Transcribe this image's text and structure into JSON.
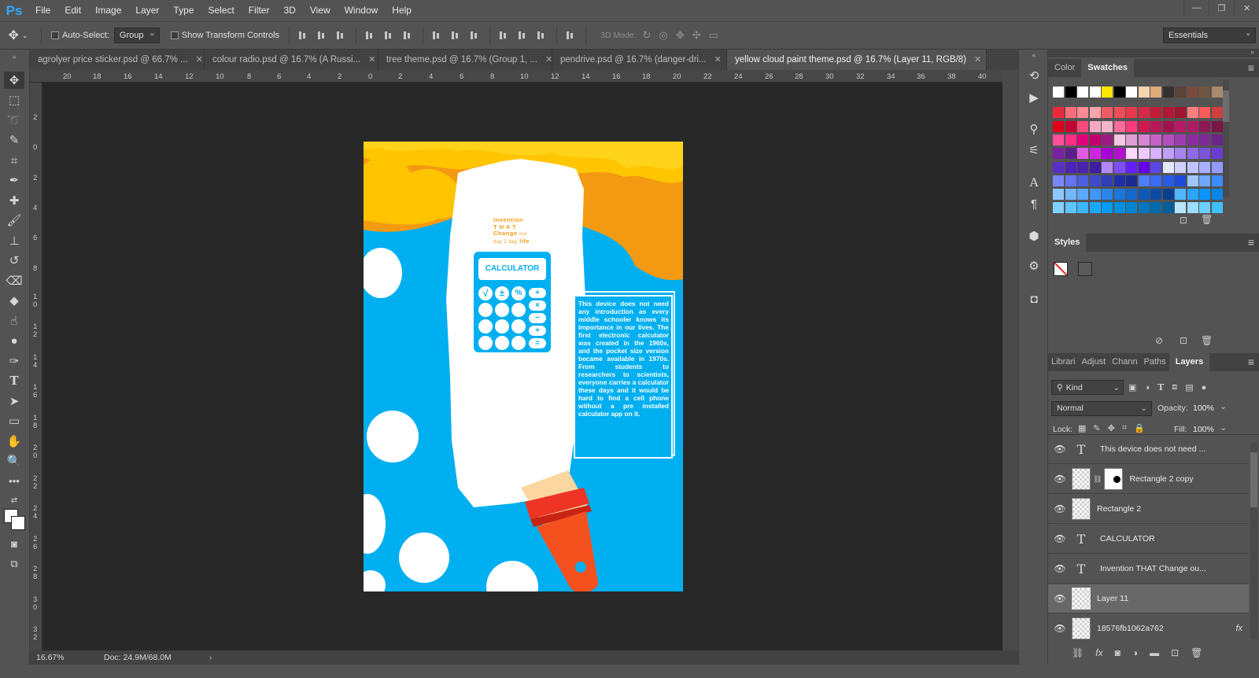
{
  "app": {
    "logo": "Ps"
  },
  "menu": [
    "File",
    "Edit",
    "Image",
    "Layer",
    "Type",
    "Select",
    "Filter",
    "3D",
    "View",
    "Window",
    "Help"
  ],
  "options": {
    "auto_select_label": "Auto-Select:",
    "auto_select_value": "Group",
    "show_transform_label": "Show Transform Controls",
    "mode_3d_label": "3D Mode:",
    "workspace_value": "Essentials"
  },
  "doc_tabs": [
    {
      "label": "agrolyer price sticker.psd @ 66.7% ...",
      "active": false
    },
    {
      "label": "colour radio.psd @ 16.7% (A Russi...",
      "active": false
    },
    {
      "label": "tree theme.psd @ 16.7% (Group 1, ...",
      "active": false
    },
    {
      "label": "pendrive.psd @ 16.7% (danger-dri...",
      "active": false
    },
    {
      "label": "yellow cloud paint theme.psd @ 16.7% (Layer 11, RGB/8)",
      "active": true
    }
  ],
  "ruler_top": [
    "20",
    "18",
    "16",
    "14",
    "12",
    "10",
    "8",
    "6",
    "4",
    "2",
    "0",
    "2",
    "4",
    "6",
    "8",
    "10",
    "12",
    "14",
    "16",
    "18",
    "20",
    "22",
    "24",
    "26",
    "28",
    "30",
    "32",
    "34",
    "36",
    "38",
    "40"
  ],
  "ruler_left": [
    "2",
    "0",
    "2",
    "4",
    "6",
    "8",
    "10",
    "12",
    "14",
    "16",
    "18",
    "20",
    "22",
    "24",
    "26",
    "28",
    "30",
    "32"
  ],
  "status": {
    "zoom": "16.67%",
    "doc": "Doc: 24.9M/68.0M"
  },
  "artwork": {
    "headline_1": "Invention",
    "headline_2": "T H A T",
    "headline_3": "Change",
    "headline_3b": "our",
    "headline_4": "day 2 day",
    "headline_4b": "life",
    "calc_label": "CALCULATOR",
    "key_sqrt": "√",
    "key_pm": "±",
    "key_pct": "%",
    "key_plus": "+",
    "key_times": "×",
    "key_minus": "−",
    "key_plus2": "+",
    "key_eq": "=",
    "body": "This device does not need any introduction as every middle schooler knows its importance in our lives. The first electronic calculator was created in the 1960s, and the pocket size version became available in 1970s. From students to researchers to scientists, everyone carries a calculator these days and it would be hard to find a cell phone without a pre installed calculator app on it."
  },
  "panels": {
    "color_tab": "Color",
    "swatches_tab": "Swatches",
    "styles_tab": "Styles",
    "layer_tabs": [
      "Librari",
      "Adjust",
      "Chann",
      "Paths",
      "Layers"
    ],
    "kind_label": "Kind",
    "blend_mode": "Normal",
    "opacity_label": "Opacity:",
    "opacity_value": "100%",
    "lock_label": "Lock:",
    "fill_label": "Fill:",
    "fill_value": "100%"
  },
  "layers": [
    {
      "name": "This device does not need ...",
      "type": "text",
      "selected": false
    },
    {
      "name": "Rectangle 2 copy",
      "type": "masked",
      "selected": false
    },
    {
      "name": "Rectangle 2",
      "type": "shape",
      "selected": false
    },
    {
      "name": "CALCULATOR",
      "type": "text",
      "selected": false
    },
    {
      "name": "Invention THAT Change ou...",
      "type": "text",
      "selected": false
    },
    {
      "name": "Layer 11",
      "type": "pixel",
      "selected": true
    },
    {
      "name": "18576fb1062a762",
      "type": "pixel-fx",
      "selected": false
    }
  ],
  "swatch_colors": {
    "row0": [
      "#ffffff",
      "#000000",
      "#ffffff",
      "#ffffff",
      "#ffe600",
      "#000000",
      "#ffffff",
      "#f5d3b0",
      "#e0a97a",
      "#333333",
      "#5a4435",
      "#7b4a3c",
      "#6f5642",
      "#a88a6f"
    ],
    "row1": [
      "#ee2a3a",
      "#ff6d79",
      "#ff8a98",
      "#f6a4aa",
      "#f05b62",
      "#ed4c56",
      "#e6394b",
      "#d72848",
      "#c41d3a",
      "#b11933",
      "#9f1531",
      "#ff7f7f",
      "#ff5a5a",
      "#cf3f3f"
    ],
    "row2": [
      "#e1001a",
      "#c4002e",
      "#ff4a7c",
      "#f5aac2",
      "#f5b5c9",
      "#ff6b9b",
      "#ff3b7c",
      "#d1174f",
      "#ba175a",
      "#a2124f",
      "#b81b64",
      "#ad1d62",
      "#8e1a54",
      "#7a1548"
    ],
    "row3": [
      "#ff4f9a",
      "#ff2f86",
      "#e2007a",
      "#c0006e",
      "#9d1a80",
      "#f7c6e2",
      "#e0a0d4",
      "#d786d3",
      "#c662c6",
      "#b34fc0",
      "#9c3bb0",
      "#8c2ca0",
      "#7e2a99",
      "#6a2589"
    ],
    "row4": [
      "#7b1fa2",
      "#5c1d8c",
      "#e45be3",
      "#d025e0",
      "#a800d8",
      "#b40fd0",
      "#ffd8ff",
      "#ecc9ff",
      "#d8b1ff",
      "#c09ff7",
      "#a685f0",
      "#8f6ae6",
      "#7c53dc",
      "#6a3cd2"
    ],
    "row5": [
      "#5a2fc8",
      "#4c24b7",
      "#4a22ad",
      "#3d1ea0",
      "#b388ff",
      "#7c4dff",
      "#651fff",
      "#6200ea",
      "#5a46e0",
      "#e6e6ff",
      "#cfd1ff",
      "#bfc4ff",
      "#a8b0ff",
      "#929cff"
    ],
    "row6": [
      "#7a88ff",
      "#6573f0",
      "#4e5ee0",
      "#3d4bcb",
      "#2f3db7",
      "#1f2fa3",
      "#1a2a8f",
      "#4d7dff",
      "#3b6cf5",
      "#2a5be8",
      "#1d4cd9",
      "#9ec5ff",
      "#6ea8ff",
      "#3e8bff"
    ],
    "row7": [
      "#8fc8ff",
      "#73b8ff",
      "#5aa9ff",
      "#3f97f7",
      "#2a86ea",
      "#1c75db",
      "#1567c9",
      "#0f59b6",
      "#0c4ca3",
      "#0a3f8f",
      "#4fb6ff",
      "#2ba5ff",
      "#0b95ff",
      "#0a86e6"
    ],
    "row8": [
      "#7fd2ff",
      "#5fc5ff",
      "#3cb7ff",
      "#1aa9ff",
      "#009bf2",
      "#0090e0",
      "#0084cf",
      "#0077bd",
      "#006bab",
      "#005f99",
      "#b7e6ff",
      "#9bdcff",
      "#6dcfff",
      "#40c1ff"
    ]
  }
}
